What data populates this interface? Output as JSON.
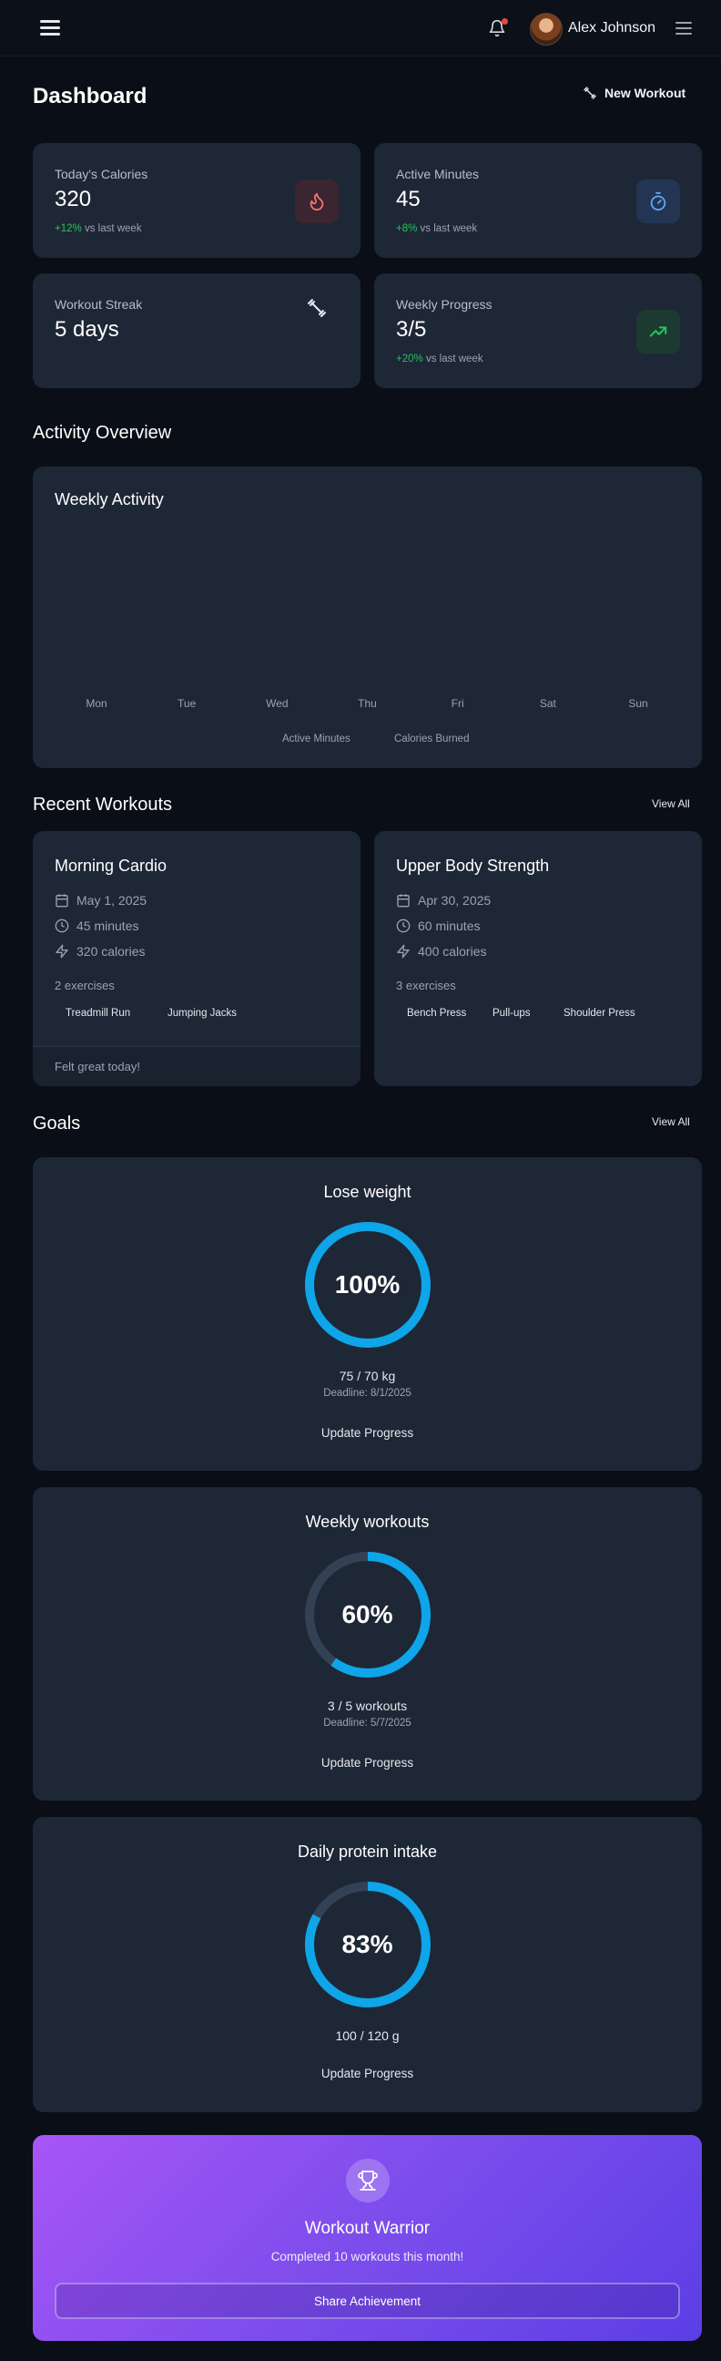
{
  "header": {
    "user_name": "Alex Johnson",
    "menu_icon": "hamburger-icon",
    "notifications_icon": "bell-icon",
    "notification_dot_color": "#ef4444"
  },
  "page": {
    "title": "Dashboard",
    "new_workout_label": "New Workout"
  },
  "stats": [
    {
      "label": "Today's Calories",
      "value": "320",
      "change": "+12%",
      "change_suffix": "vs last week",
      "icon": "flame-icon",
      "color": "#f87171"
    },
    {
      "label": "Active Minutes",
      "value": "45",
      "change": "+8%",
      "change_suffix": "vs last week",
      "icon": "timer-icon",
      "color": "#60a5fa"
    },
    {
      "label": "Workout Streak",
      "value": "5 days",
      "icon": "dumbbell-icon",
      "color": "#e5e7eb"
    },
    {
      "label": "Weekly Progress",
      "value": "3/5",
      "change": "+20%",
      "change_suffix": "vs last week",
      "icon": "trending-up-icon",
      "color": "#22c55e"
    }
  ],
  "activity": {
    "section_title": "Activity Overview",
    "chart_title": "Weekly Activity"
  },
  "chart_data": {
    "type": "bar",
    "title": "Weekly Activity",
    "categories": [
      "Mon",
      "Tue",
      "Wed",
      "Thu",
      "Fri",
      "Sat",
      "Sun"
    ],
    "series": [
      {
        "name": "Active Minutes",
        "values": []
      },
      {
        "name": "Calories Burned",
        "values": []
      }
    ],
    "legend": "bottom"
  },
  "recent": {
    "section_title": "Recent Workouts",
    "view_all": "View All",
    "workouts": [
      {
        "name": "Morning Cardio",
        "date": "May 1, 2025",
        "duration": "45 minutes",
        "calories": "320 calories",
        "exercise_count": "2 exercises",
        "exercises": [
          "Treadmill Run",
          "Jumping Jacks"
        ],
        "notes": "Felt great today!"
      },
      {
        "name": "Upper Body Strength",
        "date": "Apr 30, 2025",
        "duration": "60 minutes",
        "calories": "400 calories",
        "exercise_count": "3 exercises",
        "exercises": [
          "Bench Press",
          "Pull-ups",
          "Shoulder Press"
        ]
      }
    ]
  },
  "goals": {
    "section_title": "Goals",
    "view_all": "View All",
    "update_label": "Update Progress",
    "items": [
      {
        "title": "Lose weight",
        "percent_label": "100%",
        "progress": 1.0,
        "values": "75 / 70 kg",
        "deadline": "Deadline: 8/1/2025"
      },
      {
        "title": "Weekly workouts",
        "percent_label": "60%",
        "progress": 0.6,
        "values": "3 / 5 workouts",
        "deadline": "Deadline: 5/7/2025"
      },
      {
        "title": "Daily protein intake",
        "percent_label": "83%",
        "progress": 0.83,
        "values": "100 / 120 g"
      }
    ],
    "ring_color": "#0ea5e9",
    "track_color": "#334155"
  },
  "achievement": {
    "icon": "trophy-icon",
    "title": "Workout Warrior",
    "description": "Completed 10 workouts this month!",
    "button": "Share Achievement"
  }
}
